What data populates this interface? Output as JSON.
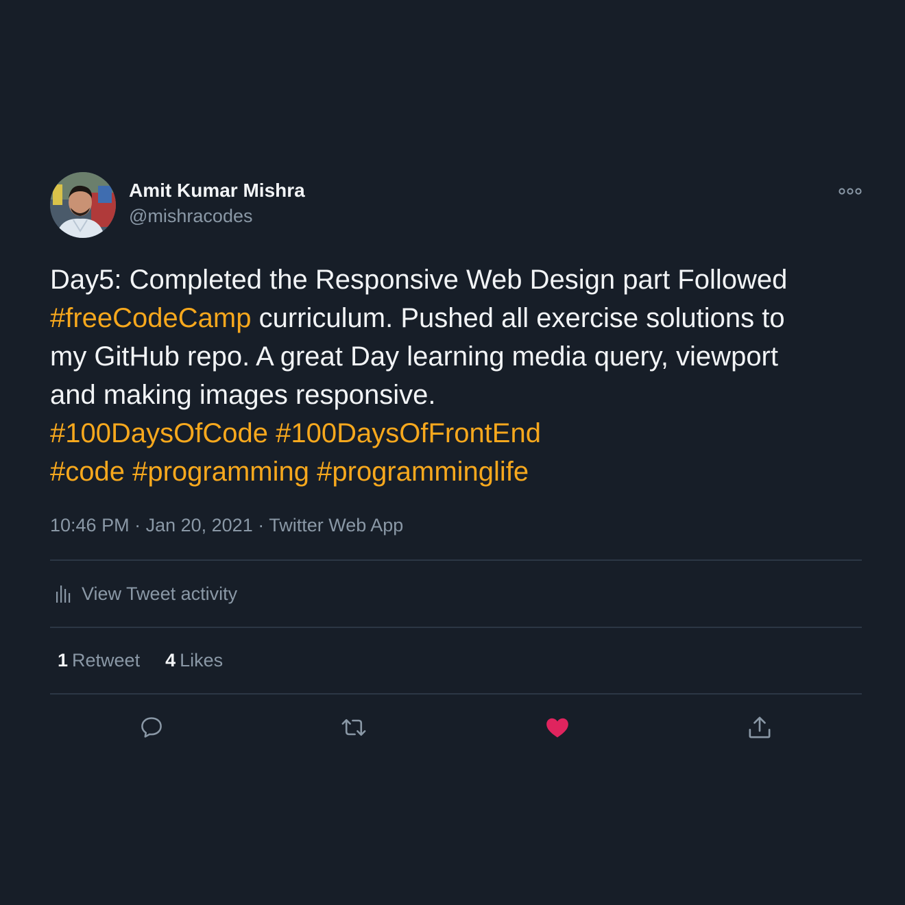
{
  "tweet": {
    "author": {
      "display_name": "Amit Kumar Mishra",
      "handle": "@mishracodes",
      "avatar_icon": "user-avatar-photo"
    },
    "more_icon": "more-options-icon",
    "text_lines": [
      [
        {
          "t": "Day5: Completed the Responsive Web Design part Followed",
          "tag": false
        }
      ],
      [
        {
          "t": "#freeCodeCamp",
          "tag": true
        },
        {
          "t": " curriculum. Pushed all exercise solutions to",
          "tag": false
        }
      ],
      [
        {
          "t": "my GitHub repo. A great Day learning media query, viewport",
          "tag": false
        }
      ],
      [
        {
          "t": "and making images responsive.",
          "tag": false
        }
      ],
      [
        {
          "t": "#100DaysOfCode",
          "tag": true
        },
        {
          "t": " ",
          "tag": false
        },
        {
          "t": "#100DaysOfFrontEnd",
          "tag": true
        }
      ],
      [
        {
          "t": "#code",
          "tag": true
        },
        {
          "t": " ",
          "tag": false
        },
        {
          "t": "#programming",
          "tag": true
        },
        {
          "t": " ",
          "tag": false
        },
        {
          "t": "#programminglife",
          "tag": true
        }
      ]
    ],
    "time": "10:46 PM",
    "date": "Jan 20, 2021",
    "separator": " · ",
    "source": "Twitter Web App",
    "activity_label": "View Tweet activity",
    "retweets_count": "1",
    "retweets_label": "Retweet",
    "likes_count": "4",
    "likes_label": "Likes"
  },
  "actions": [
    {
      "name": "reply-icon"
    },
    {
      "name": "retweet-icon"
    },
    {
      "name": "like-icon",
      "active": true
    },
    {
      "name": "share-icon"
    }
  ],
  "colors": {
    "background": "#171e28",
    "text": "#f2f4f6",
    "secondary": "#8a98a6",
    "hashtag": "#f7a81d",
    "like": "#e0245e",
    "divider": "#2c3745"
  }
}
